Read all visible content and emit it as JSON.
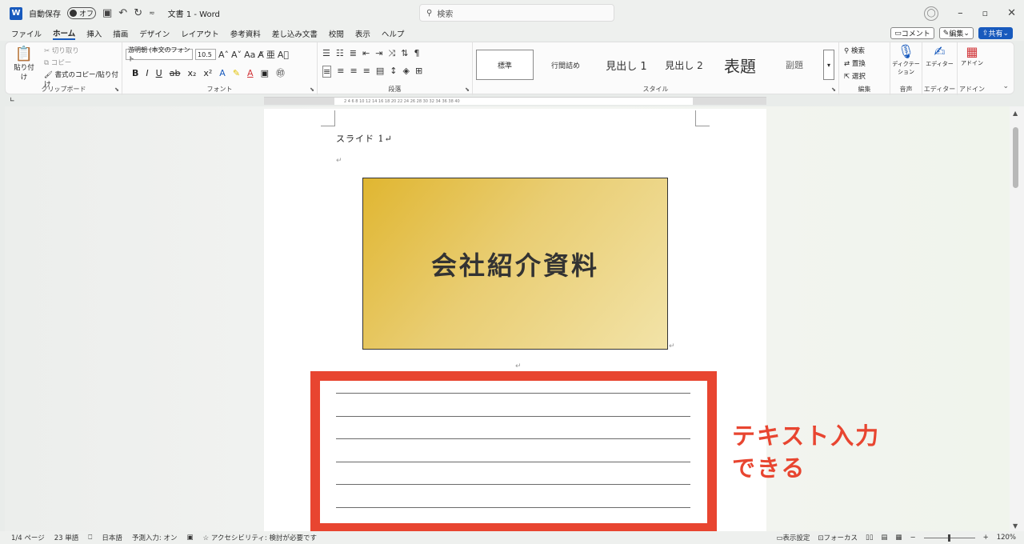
{
  "titlebar": {
    "autosave_label": "自動保存",
    "autosave_state": "オフ",
    "doc_title": "文書 1  -  Word",
    "search_placeholder": "検索"
  },
  "tabs": [
    "ファイル",
    "ホーム",
    "挿入",
    "描画",
    "デザイン",
    "レイアウト",
    "参考資料",
    "差し込み文書",
    "校閲",
    "表示",
    "ヘルプ"
  ],
  "active_tab": "ホーム",
  "tab_buttons": {
    "comment": "コメント",
    "edit": "編集",
    "share": "共有"
  },
  "ribbon": {
    "clipboard": {
      "paste": "貼り付け",
      "cut": "切り取り",
      "copy": "コピー",
      "format_painter": "書式のコピー/貼り付け",
      "label": "クリップボード"
    },
    "font": {
      "font_name": "游明朝 (本文のフォント",
      "font_size": "10.5",
      "label": "フォント"
    },
    "paragraph": {
      "label": "段落"
    },
    "styles": {
      "items": [
        "標準",
        "行間詰め",
        "見出し 1",
        "見出し 2",
        "表題",
        "副題"
      ],
      "label": "スタイル"
    },
    "editing": {
      "find": "検索",
      "replace": "置換",
      "select": "選択",
      "label": "編集"
    },
    "voice": {
      "dictate": "ディクテーション",
      "label": "音声"
    },
    "editor": {
      "name": "エディター",
      "label": "エディター"
    },
    "addins": {
      "name": "アドイン",
      "label": "アドイン"
    }
  },
  "ruler_text": "2  4  6  8  10  12  14  16  18  20  22  24  26  28  30  32  34  36  38  40",
  "document": {
    "slide_label": "スライド 1↵",
    "slide_title": "会社紹介資料",
    "para_mark": "↵"
  },
  "annotation": {
    "line1": "テキスト入力",
    "line2": "できる",
    "color": "#e84530"
  },
  "statusbar": {
    "page": "1/4 ページ",
    "words": "23 単語",
    "language": "日本語",
    "predictive": "予測入力: オン",
    "accessibility": "アクセシビリティ: 検討が必要です",
    "display_settings": "表示設定",
    "focus": "フォーカス",
    "zoom": "120%"
  }
}
